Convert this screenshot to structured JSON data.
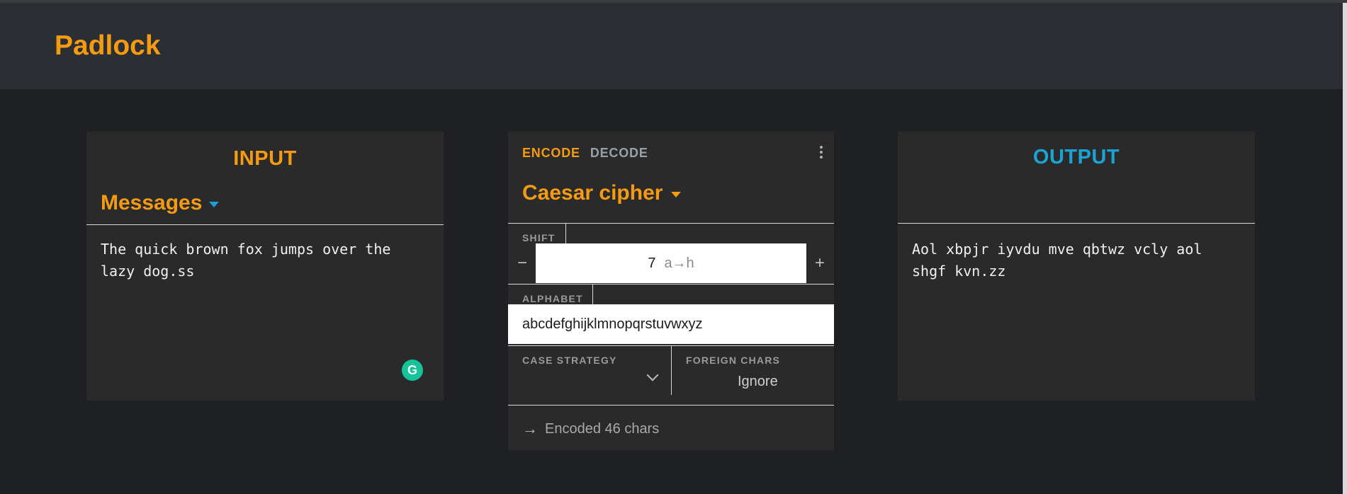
{
  "app": {
    "title": "Padlock"
  },
  "input_panel": {
    "heading": "INPUT",
    "format": "Messages",
    "text": "The quick brown fox jumps over the\nlazy dog.ss"
  },
  "cipher_panel": {
    "tabs": {
      "encode": "ENCODE",
      "decode": "DECODE"
    },
    "cipher": "Caesar cipher",
    "shift": {
      "label": "SHIFT",
      "value": "7",
      "mapping": "a→h",
      "decrement": "−",
      "increment": "+"
    },
    "alphabet": {
      "label": "ALPHABET",
      "value": "abcdefghijklmnopqrstuvwxyz"
    },
    "case_strategy": {
      "label": "CASE STRATEGY",
      "value": ""
    },
    "foreign_chars": {
      "label": "FOREIGN CHARS",
      "value": "Ignore"
    },
    "status": "Encoded 46 chars"
  },
  "output_panel": {
    "heading": "OUTPUT",
    "text": "Aol xbpjr iyvdu mve qbtwz vcly aol\nshgf kvn.zz"
  },
  "colors": {
    "accent": "#f59b13",
    "secondary": "#1aa3d3",
    "background": "#1f2023",
    "panel": "#2a2a2b"
  }
}
